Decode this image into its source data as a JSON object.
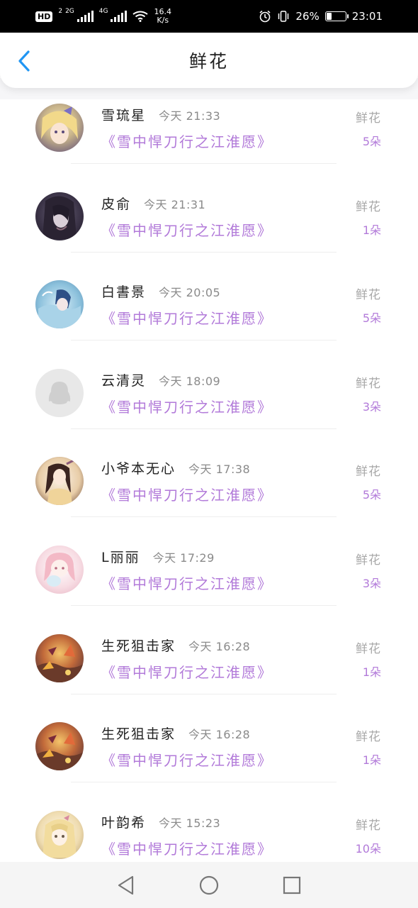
{
  "status_bar": {
    "hd": "HD",
    "sim": "2",
    "net1": "2G",
    "net2": "4G",
    "speed_value": "16.4",
    "speed_unit": "K/s",
    "battery_percent": "26%",
    "battery_level": 0.26,
    "time": "23:01",
    "icons": [
      "alarm-icon",
      "vibrate-icon",
      "battery-icon",
      "wifi-icon",
      "signal-icon"
    ]
  },
  "header": {
    "title": "鲜花",
    "back_icon": "chevron-left-icon",
    "accent": "#2196f3"
  },
  "colors": {
    "book_title": "#b27ad9",
    "gift_count": "#b27ad9",
    "label_gray": "#a8a8a8"
  },
  "items": [
    {
      "name": "雪琉星",
      "time": "今天 21:33",
      "book": "《雪中悍刀行之江淮愿》",
      "gift": "鲜花",
      "count": "5朵",
      "avatar": "anime-girl-blonde"
    },
    {
      "name": "皮俞",
      "time": "今天 21:31",
      "book": "《雪中悍刀行之江淮愿》",
      "gift": "鲜花",
      "count": "1朵",
      "avatar": "dark-haired-figure"
    },
    {
      "name": "白書景",
      "time": "今天 20:05",
      "book": "《雪中悍刀行之江淮愿》",
      "gift": "鲜花",
      "count": "5朵",
      "avatar": "blue-water-anime"
    },
    {
      "name": "云清灵",
      "time": "今天 18:09",
      "book": "《雪中悍刀行之江淮愿》",
      "gift": "鲜花",
      "count": "3朵",
      "avatar": "default-penguin"
    },
    {
      "name": "小爷本无心",
      "time": "今天 17:38",
      "book": "《雪中悍刀行之江淮愿》",
      "gift": "鲜花",
      "count": "5朵",
      "avatar": "anime-girl-traditional"
    },
    {
      "name": "L丽丽",
      "time": "今天 17:29",
      "book": "《雪中悍刀行之江淮愿》",
      "gift": "鲜花",
      "count": "3朵",
      "avatar": "pink-hair-chibi"
    },
    {
      "name": "生死狙击家",
      "time": "今天 16:28",
      "book": "《雪中悍刀行之江淮愿》",
      "gift": "鲜花",
      "count": "1朵",
      "avatar": "fiery-scene"
    },
    {
      "name": "生死狙击家",
      "time": "今天 16:28",
      "book": "《雪中悍刀行之江淮愿》",
      "gift": "鲜花",
      "count": "1朵",
      "avatar": "fiery-scene"
    },
    {
      "name": "叶韵希",
      "time": "今天 15:23",
      "book": "《雪中悍刀行之江淮愿》",
      "gift": "鲜花",
      "count": "10朵",
      "avatar": "anime-girl-blonde-long"
    }
  ],
  "nav": {
    "back_icon": "triangle-back-icon",
    "home_icon": "circle-home-icon",
    "recent_icon": "square-recent-icon"
  }
}
